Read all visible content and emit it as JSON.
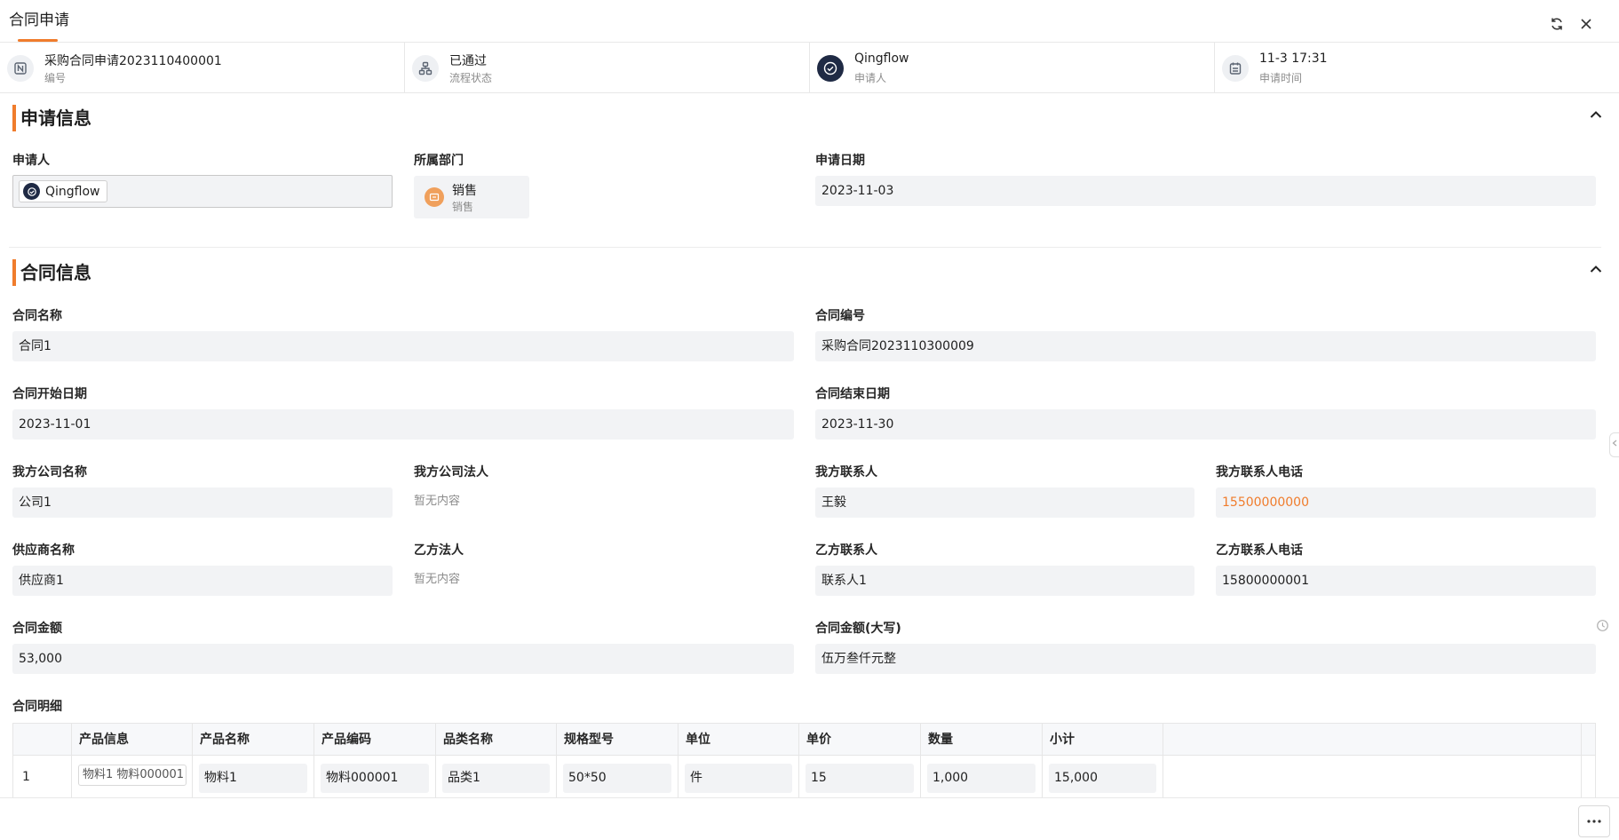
{
  "header": {
    "title": "合同申请",
    "refresh_icon": "refresh-icon",
    "close_icon": "close-icon"
  },
  "status": [
    {
      "icon": "number-icon",
      "value": "采购合同申请2023110400001",
      "label": "编号"
    },
    {
      "icon": "flow-icon",
      "value": "已通过",
      "label": "流程状态"
    },
    {
      "icon": "user-avatar-icon",
      "value": "Qingflow",
      "label": "申请人"
    },
    {
      "icon": "calendar-icon",
      "value": "11-3 17:31",
      "label": "申请时间"
    }
  ],
  "apply_section": {
    "title": "申请信息",
    "applicant": {
      "label": "申请人",
      "value": "Qingflow"
    },
    "department": {
      "label": "所属部门",
      "name": "销售",
      "sub": "销售"
    },
    "apply_date": {
      "label": "申请日期",
      "value": "2023-11-03"
    }
  },
  "contract_section": {
    "title": "合同信息",
    "contract_name": {
      "label": "合同名称",
      "value": "合同1"
    },
    "contract_no": {
      "label": "合同编号",
      "value": "采购合同2023110300009"
    },
    "start_date": {
      "label": "合同开始日期",
      "value": "2023-11-01"
    },
    "end_date": {
      "label": "合同结束日期",
      "value": "2023-11-30"
    },
    "our_company": {
      "label": "我方公司名称",
      "value": "公司1"
    },
    "our_legal": {
      "label": "我方公司法人",
      "value": "暂无内容"
    },
    "our_contact": {
      "label": "我方联系人",
      "value": "王毅"
    },
    "our_phone": {
      "label": "我方联系人电话",
      "value": "15500000000"
    },
    "supplier": {
      "label": "供应商名称",
      "value": "供应商1"
    },
    "party_b_legal": {
      "label": "乙方法人",
      "value": "暂无内容"
    },
    "party_b_contact": {
      "label": "乙方联系人",
      "value": "联系人1"
    },
    "party_b_phone": {
      "label": "乙方联系人电话",
      "value": "15800000001"
    },
    "amount": {
      "label": "合同金额",
      "value": "53,000"
    },
    "amount_upper": {
      "label": "合同金额(大写)",
      "value": "伍万叁仟元整"
    },
    "detail_label": "合同明细"
  },
  "detail_table": {
    "columns": [
      "产品信息",
      "产品名称",
      "产品编码",
      "品类名称",
      "规格型号",
      "单位",
      "单价",
      "数量",
      "小计"
    ],
    "rows": [
      {
        "index": "1",
        "cells": [
          "物料1 物料000001",
          "物料1",
          "物料000001",
          "品类1",
          "50*50",
          "件",
          "15",
          "1,000",
          "15,000"
        ]
      }
    ]
  },
  "colors": {
    "accent": "#f07c2c",
    "phone_link": "#f07c2c"
  }
}
